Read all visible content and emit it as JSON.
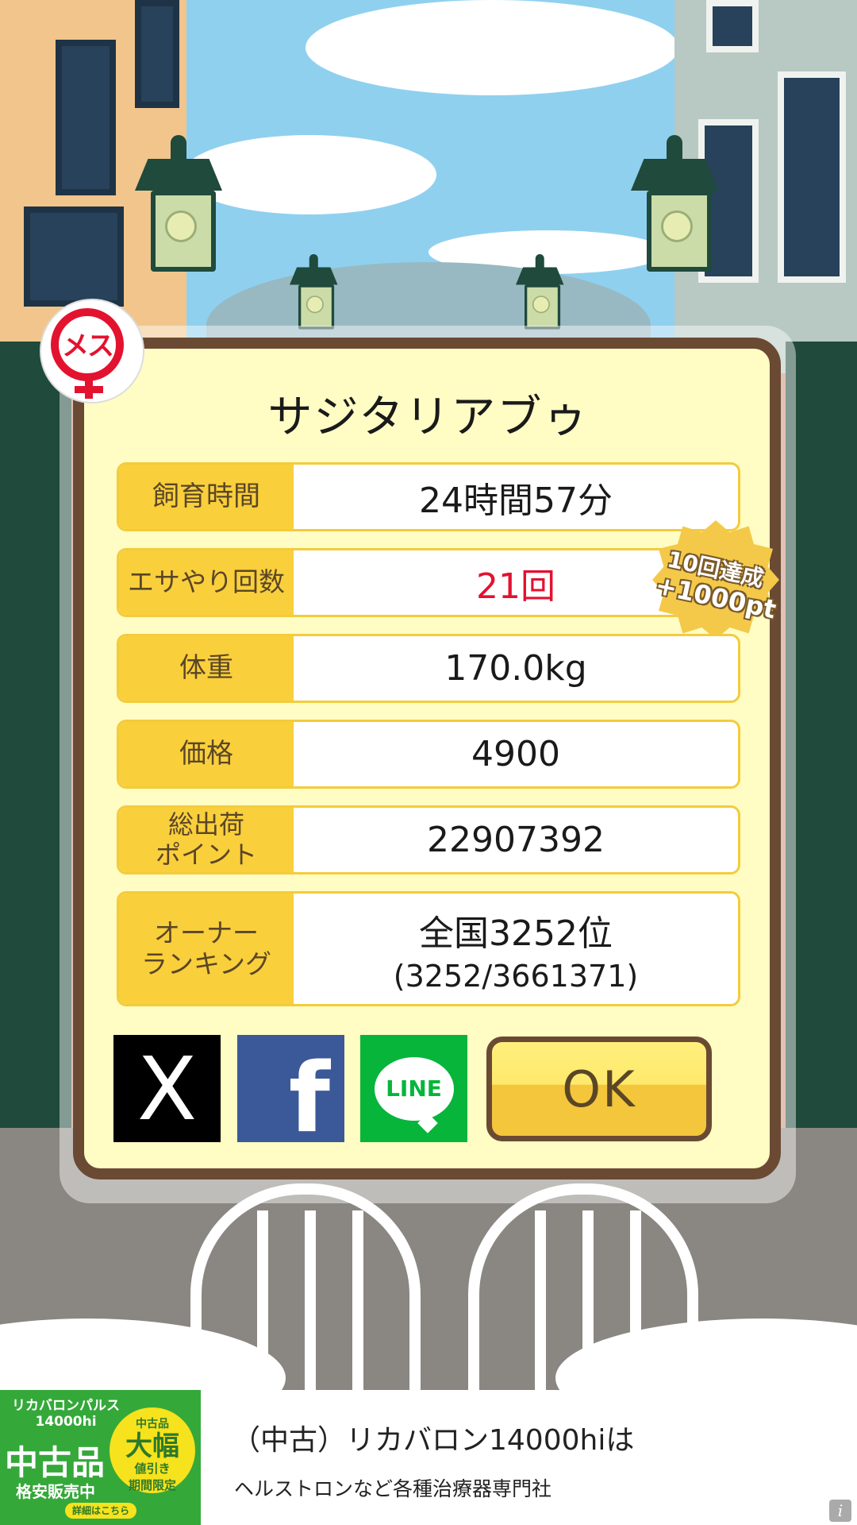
{
  "pig": {
    "name": "サジタリアブゥ",
    "gender_label": "メス"
  },
  "stats": [
    {
      "label": "飼育時間",
      "value": "24時間57分"
    },
    {
      "label": "エサやり回数",
      "value": "21回"
    },
    {
      "label": "体重",
      "value": "170.0kg"
    },
    {
      "label": "価格",
      "value": "4900"
    },
    {
      "label": "総出荷\nポイント",
      "value": "22907392"
    },
    {
      "label": "オーナー\nランキング",
      "value": "全国3252位",
      "sub_value": "(3252/3661371)"
    }
  ],
  "achievement": {
    "line1": "10回達成",
    "line2": "+1000pt"
  },
  "share": {
    "x_glyph": "X",
    "facebook_glyph": "f",
    "line_label": "LINE"
  },
  "ok_button": "OK",
  "ad": {
    "image": {
      "line1": "リカバロンパルス\n14000hi",
      "big": "中古品",
      "sub": "格安販売中",
      "seal_top": "中古品",
      "seal_big": "大幅",
      "seal_side": "値引き",
      "seal_bottom": "期間限定",
      "button": "詳細はこちら"
    },
    "title": "（中古）リカバロン14000hiは",
    "description": "ヘルストロンなど各種治療器専門社",
    "info_glyph": "i"
  },
  "colors": {
    "dialog_bg": "#fffcc4",
    "dialog_border": "#6a4a33",
    "label_bg": "#f9cf3c",
    "highlight_red": "#e3122f",
    "ok_button": "#f3c63c"
  }
}
